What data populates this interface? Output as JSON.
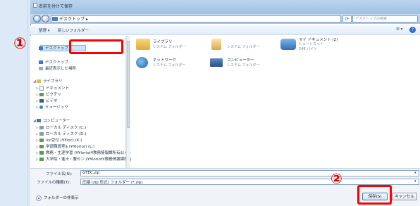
{
  "window": {
    "title": "名前を付けて保存"
  },
  "navigation": {
    "address": "デスクトップ ▸",
    "search_placeholder": "デスクトップの検索"
  },
  "toolbar": {
    "organize_label": "整理 ▾",
    "new_folder_label": "新しいフォルダー",
    "view_label": "☰ ▾",
    "help_label": "?"
  },
  "nav_pane": {
    "favorites": [
      {
        "label": "デスクトップ",
        "icon": "desktop-icon",
        "selected": true
      },
      {
        "label": "デスクトップ",
        "icon": "desktop-icon"
      },
      {
        "label": "最近表示した場所",
        "icon": "recent-places-icon"
      }
    ],
    "libraries_header": "ライブラリ",
    "libraries": [
      {
        "label": "ドキュメント",
        "icon": "documents-icon"
      },
      {
        "label": "ピクチャ",
        "icon": "pictures-icon"
      },
      {
        "label": "ビデオ",
        "icon": "videos-icon"
      },
      {
        "label": "ミュージック",
        "icon": "music-icon"
      }
    ],
    "computer_header": "コンピューター",
    "drives": [
      {
        "label": "ローカル ディスク (C:)",
        "icon": "drive-icon"
      },
      {
        "label": "ローカル ディスク (D:)",
        "icon": "drive-icon"
      },
      {
        "label": "loc受付 (¥¥loc) (K:)",
        "icon": "network-drive-icon"
      },
      {
        "label": "学部職員室$ (¥¥loriot) (L:)",
        "icon": "network-drive-icon"
      },
      {
        "label": "教務・生涯学習 (¥¥loriot¥教務情報課所有$) (N:)",
        "icon": "network-drive-icon"
      },
      {
        "label": "大学院・進士・要セン (¥¥loriot¥教務情報課所有",
        "icon": "network-drive-icon"
      }
    ]
  },
  "content": {
    "items": [
      {
        "name": "ライブラリ",
        "sub": "システム フォルダー",
        "sub2": "",
        "icon": "libraries-folder-icon"
      },
      {
        "name": "",
        "sub": "システム フォルダー",
        "sub2": "",
        "icon": "user-folder-icon"
      },
      {
        "name": "マイ ドキュメント (2)",
        "sub": "ショートカット",
        "sub2": "248 バイト",
        "icon": "shortcut-icon"
      },
      {
        "name": "ネットワーク",
        "sub": "システム フォルダー",
        "sub2": "",
        "icon": "network-icon"
      },
      {
        "name": "コンピューター",
        "sub": "システム フォルダー",
        "sub2": "",
        "icon": "computer-icon"
      }
    ]
  },
  "bottom": {
    "filename_label": "ファイル名(N):",
    "filename_value": "GTEC.zip",
    "filetype_label": "ファイルの種類(T):",
    "filetype_value": "圧縮 (zip 形式) フォルダー (*.zip)",
    "hide_folders_label": "フォルダーの非表示",
    "save_label": "保存(S)",
    "cancel_label": "キャンセル"
  },
  "annotations": {
    "marker_1": "①",
    "marker_2": "②",
    "color": "#ff0000"
  }
}
